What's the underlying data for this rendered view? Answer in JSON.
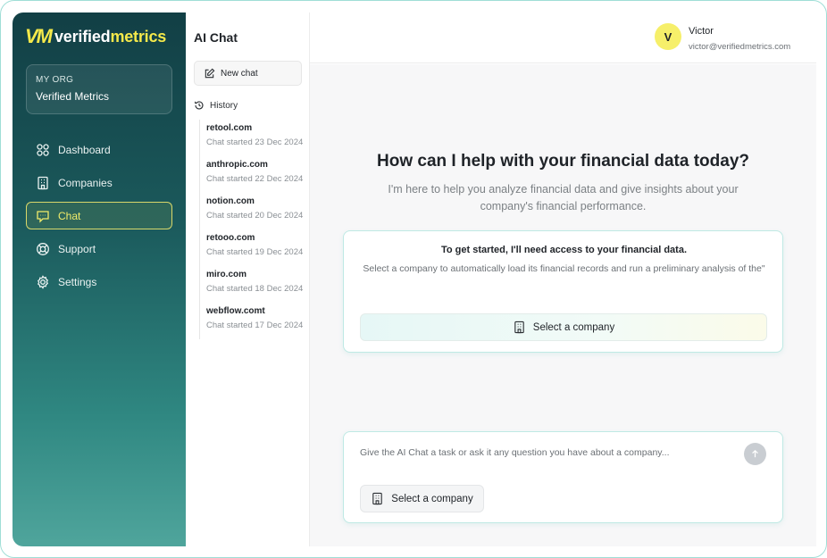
{
  "brand": {
    "mark": "VM",
    "name_part1": "verified",
    "name_part2": "metrics",
    "accent_color": "#f5e94a"
  },
  "org": {
    "label": "MY ORG",
    "name": "Verified Metrics"
  },
  "nav": {
    "items": [
      {
        "label": "Dashboard",
        "icon": "grid-icon",
        "active": false
      },
      {
        "label": "Companies",
        "icon": "building-icon",
        "active": false
      },
      {
        "label": "Chat",
        "icon": "chat-icon",
        "active": true
      },
      {
        "label": "Support",
        "icon": "lifebuoy-icon",
        "active": false
      },
      {
        "label": "Settings",
        "icon": "gear-icon",
        "active": false
      }
    ]
  },
  "history_panel": {
    "title": "AI Chat",
    "new_chat_label": "New chat",
    "history_label": "History",
    "items": [
      {
        "title": "retool.com",
        "subtitle": "Chat started 23 Dec 2024"
      },
      {
        "title": "anthropic.com",
        "subtitle": "Chat started 22 Dec 2024"
      },
      {
        "title": "notion.com",
        "subtitle": "Chat started 20 Dec 2024"
      },
      {
        "title": "retooo.com",
        "subtitle": "Chat started 19 Dec 2024"
      },
      {
        "title": "miro.com",
        "subtitle": "Chat started 18 Dec 2024"
      },
      {
        "title": "webflow.comt",
        "subtitle": "Chat started 17 Dec 2024"
      }
    ]
  },
  "user": {
    "initial": "V",
    "name": "Victor",
    "email": "victor@verifiedmetrics.com"
  },
  "main": {
    "heading": "How can I help with your financial data today?",
    "subheading": "I'm here to help you analyze financial data and give insights about your company's financial performance.",
    "card": {
      "title": "To get started, I'll need access to your financial data.",
      "text": "Select a company to automatically load its financial records and run a preliminary analysis of the\"",
      "button_label": "Select a company"
    },
    "composer": {
      "placeholder": "Give the AI Chat a task or ask it any question you have about a company...",
      "select_label": "Select a company"
    }
  }
}
